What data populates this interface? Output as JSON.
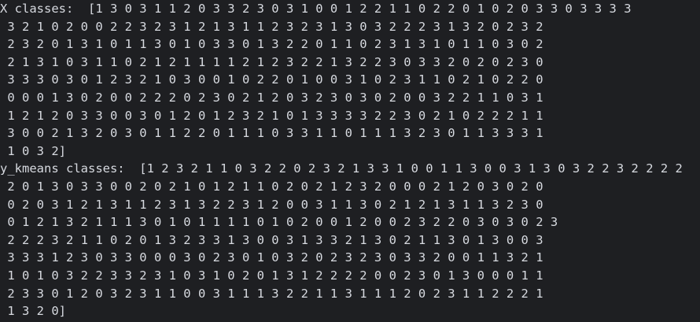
{
  "terminal": {
    "lines": [
      "X classes:  [1 3 0 3 1 1 2 0 3 3 2 3 0 3 1 0 0 1 2 2 1 1 0 2 2 0 1 0 2 0 3 3 0 3 3 3 3",
      " 3 2 1 0 2 0 0 2 2 3 2 3 1 2 1 3 1 1 2 3 2 3 1 3 0 3 2 2 2 3 1 3 2 0 2 3 2",
      " 2 3 2 0 1 3 1 0 1 1 3 0 1 0 3 3 0 1 3 2 2 0 1 1 0 2 3 1 3 1 0 1 1 0 3 0 2",
      " 2 1 3 1 0 3 1 1 0 2 1 2 1 1 1 1 2 1 2 3 2 2 1 3 2 2 3 0 3 3 2 0 2 0 2 3 0",
      " 3 3 3 0 3 0 1 2 3 2 1 0 3 0 0 1 0 2 2 0 1 0 0 3 1 0 2 3 1 1 0 2 1 0 2 2 0",
      " 0 0 0 1 3 0 2 0 0 2 2 2 0 2 3 0 2 1 2 0 3 2 3 0 3 0 2 0 0 3 2 2 1 1 0 3 1",
      " 1 2 1 2 0 3 3 0 0 3 0 1 2 0 1 2 3 2 1 0 1 3 3 3 3 2 2 3 0 2 1 0 2 2 2 1 1",
      " 3 0 0 2 1 3 2 0 3 0 1 1 2 2 0 1 1 1 0 3 3 1 1 0 1 1 1 3 2 3 0 1 1 3 3 3 1",
      " 1 0 3 2]",
      "y_kmeans classes:  [1 2 3 2 1 1 0 3 2 2 0 2 3 2 1 3 3 1 0 0 1 1 3 0 0 3 1 3 0 3 2 2 3 2 2 2 2",
      " 2 0 1 3 0 3 3 0 0 2 0 2 1 0 1 2 1 1 0 2 0 2 1 2 3 2 0 0 0 2 1 2 0 3 0 2 0",
      " 0 2 0 3 1 2 1 3 1 1 2 3 1 3 2 2 3 1 2 0 0 3 1 1 3 0 2 1 2 1 3 1 1 3 2 3 0",
      " 0 1 2 1 3 2 1 1 1 3 0 1 0 1 1 1 1 0 1 0 2 0 0 1 2 0 0 2 3 2 2 0 3 0 3 0 2 3",
      " 2 2 2 3 2 1 1 0 2 0 1 3 2 3 3 1 3 0 0 3 1 3 3 2 1 3 0 2 1 1 3 0 1 3 0 0 3",
      " 3 3 3 1 2 3 0 3 3 0 0 0 3 0 2 3 0 1 0 3 2 0 2 3 2 3 0 3 3 2 0 0 1 1 3 2 1",
      " 1 0 1 0 3 2 2 3 3 2 3 1 0 3 1 0 2 0 1 3 1 2 2 2 2 0 0 2 3 0 1 3 0 0 0 1 1",
      " 2 3 3 0 1 2 0 3 2 3 1 1 0 0 3 1 1 1 3 2 2 1 1 3 1 1 1 2 0 2 3 1 1 2 2 2 1",
      " 1 3 2 0]"
    ]
  }
}
